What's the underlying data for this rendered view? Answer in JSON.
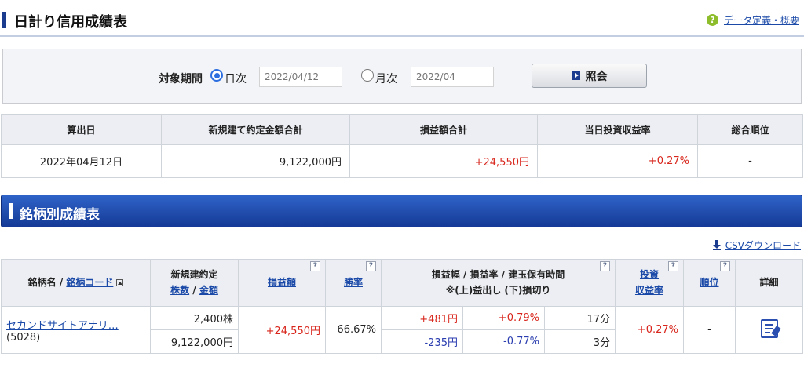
{
  "page": {
    "title": "日計り信用成績表",
    "help_link": "データ定義・概要"
  },
  "search": {
    "period_label": "対象期間",
    "daily_label": "日次",
    "daily_value": "2022/04/12",
    "monthly_label": "月次",
    "monthly_value": "2022/04",
    "daily_selected": true,
    "submit_label": "照会"
  },
  "summary": {
    "headers": [
      "算出日",
      "新規建て約定金額合計",
      "損益額合計",
      "当日投資収益率",
      "総合順位"
    ],
    "values": [
      "2022年04月12日",
      "9,122,000円",
      "+24,550円",
      "+0.27%",
      "-"
    ]
  },
  "section": {
    "title": "銘柄別成績表"
  },
  "csv_label": "CSVダウンロード",
  "detail": {
    "h_name": "銘柄名 /",
    "h_code": "銘柄コード",
    "h_new": "新規建約定",
    "h_shares": "株数",
    "h_slash": "/",
    "h_amount": "金額",
    "h_pnl": "損益額",
    "h_win": "勝率",
    "h_range": "損益幅 / 損益率 / 建玉保有時間",
    "h_range2": "※(上)益出し (下)損切り",
    "h_roi1": "投資",
    "h_roi2": "収益率",
    "h_rank": "順位",
    "h_detail": "詳細",
    "help": "?",
    "row": {
      "name": "セカンドサイトアナリ…",
      "code": "(5028)",
      "shares": "2,400株",
      "amount": "9,122,000円",
      "pnl": "+24,550円",
      "win": "66.67%",
      "up_amt": "+481円",
      "up_rate": "+0.79%",
      "up_time": "17分",
      "down_amt": "-235円",
      "down_rate": "-0.77%",
      "down_time": "3分",
      "roi": "+0.27%",
      "rank": "-"
    }
  }
}
